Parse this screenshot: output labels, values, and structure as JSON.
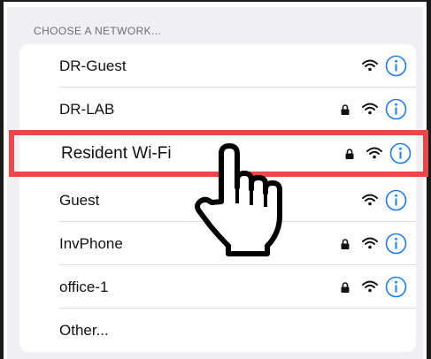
{
  "header": {
    "title": "CHOOSE A NETWORK..."
  },
  "networks": [
    {
      "name": "DR-Guest",
      "locked": false
    },
    {
      "name": "DR-LAB",
      "locked": true
    },
    {
      "name": "Resident Wi-Fi",
      "locked": true
    },
    {
      "name": "Guest",
      "locked": false
    },
    {
      "name": "InvPhone",
      "locked": true
    },
    {
      "name": "office-1",
      "locked": true
    }
  ],
  "other": {
    "label": "Other..."
  },
  "colors": {
    "accent": "#1a7cf2",
    "highlight": "#e8484a",
    "header_text": "#6d6d72"
  },
  "icons": {
    "lock": "lock-icon",
    "wifi": "wifi-icon",
    "info": "info-icon",
    "cursor": "hand-pointer-icon"
  }
}
